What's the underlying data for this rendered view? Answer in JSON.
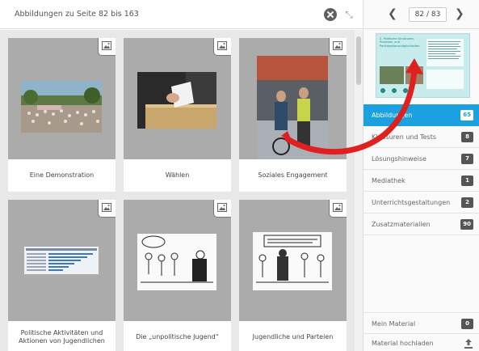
{
  "header": {
    "title": "Abbildungen zu Seite 82 bis 163",
    "close_icon": "close-icon",
    "expand_icon": "expand-icon"
  },
  "cards": [
    {
      "label": "Eine Demonstration",
      "icon": "image-icon"
    },
    {
      "label": "Wählen",
      "icon": "image-icon"
    },
    {
      "label": "Soziales Engagement",
      "icon": "image-icon"
    },
    {
      "label": "Politische Aktivitäten und Aktionen von Jugendlichen",
      "icon": "image-icon"
    },
    {
      "label": "Die „unpolitische Jugend“",
      "icon": "image-icon"
    },
    {
      "label": "Jugendliche und Parteien",
      "icon": "image-icon"
    }
  ],
  "pager": {
    "current": "82 / 83",
    "prev_icon": "chevron-left-icon",
    "next_icon": "chevron-right-icon"
  },
  "preview": {
    "heading": "2. Politische Strukturen, Prozesse, und Partizipationsmöglichkeiten"
  },
  "menu": [
    {
      "label": "Abbildungen",
      "count": "65",
      "active": true
    },
    {
      "label": "Klausuren und Tests",
      "count": "8"
    },
    {
      "label": "Lösungshinweise",
      "count": "7"
    },
    {
      "label": "Mediathek",
      "count": "1"
    },
    {
      "label": "Unterrichtsgestaltungen",
      "count": "2"
    },
    {
      "label": "Zusatzmaterialien",
      "count": "90"
    }
  ],
  "bottom_menu": [
    {
      "label": "Mein Material",
      "count": "0"
    },
    {
      "label": "Material hochladen",
      "icon": "upload-icon"
    }
  ],
  "colors": {
    "accent": "#1ba0e0",
    "arrow": "#e02020",
    "card_bg": "#ababab",
    "grid_bg": "#e8e8e8"
  }
}
